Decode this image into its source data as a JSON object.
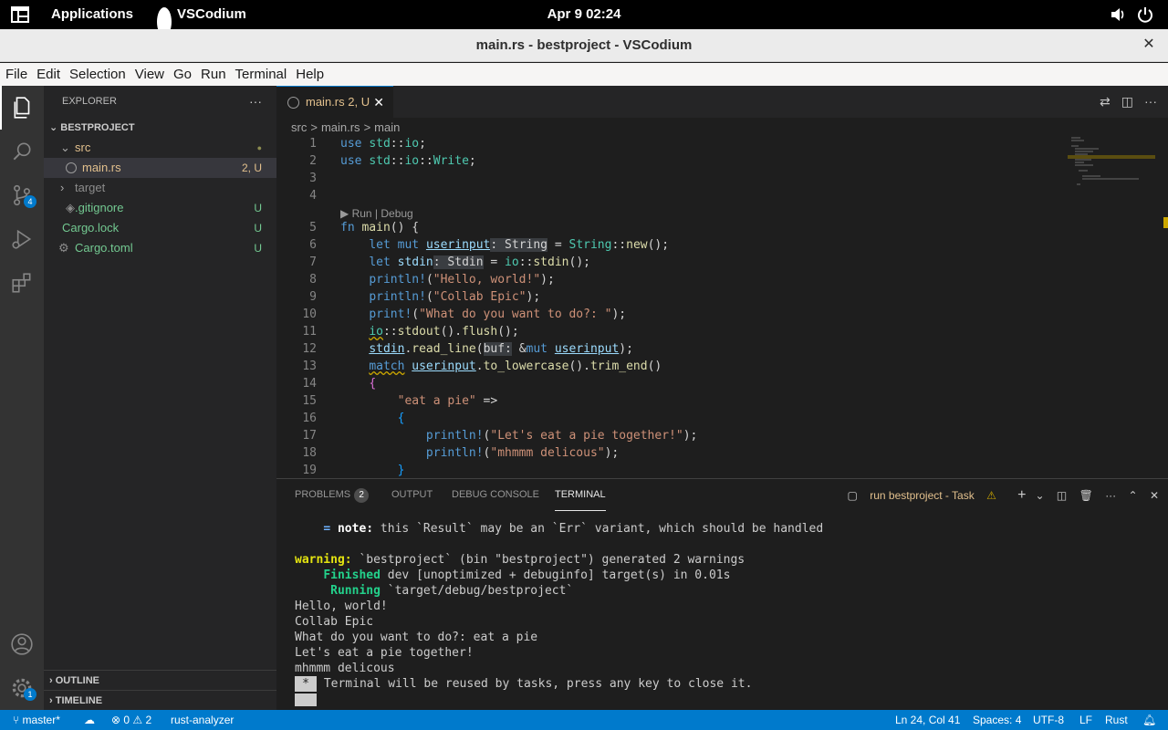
{
  "topbar": {
    "applications": "Applications",
    "app_name": "VSCodium",
    "clock": "Apr 9  02:24"
  },
  "window": {
    "title": "main.rs - bestproject - VSCodium",
    "close": "✕"
  },
  "menu": [
    "File",
    "Edit",
    "Selection",
    "View",
    "Go",
    "Run",
    "Terminal",
    "Help"
  ],
  "activity_bar": {
    "scm_badge": "4",
    "settings_badge": "1"
  },
  "explorer": {
    "header": "EXPLORER",
    "more": "···",
    "project": "BESTPROJECT",
    "items": [
      {
        "name": "src",
        "deco": "●"
      },
      {
        "name": "main.rs",
        "deco": "2, U"
      },
      {
        "name": "target",
        "deco": ""
      },
      {
        "name": ".gitignore",
        "deco": "U"
      },
      {
        "name": "Cargo.lock",
        "deco": "U"
      },
      {
        "name": "Cargo.toml",
        "deco": "U"
      }
    ],
    "outline": "OUTLINE",
    "timeline": "TIMELINE"
  },
  "editor": {
    "tab_label": "main.rs",
    "tab_status": "2, U",
    "breadcrumb": [
      "src",
      ">",
      "main.rs",
      ">",
      "main"
    ],
    "codelens": "▶ Run | Debug",
    "line_numbers": [
      "1",
      "2",
      "3",
      "4",
      "5",
      "6",
      "7",
      "8",
      "9",
      "10",
      "11",
      "12",
      "13",
      "14",
      "15",
      "16",
      "17",
      "18",
      "19"
    ]
  },
  "panel": {
    "tabs": [
      "PROBLEMS",
      "OUTPUT",
      "DEBUG CONSOLE",
      "TERMINAL"
    ],
    "problems_count": "2",
    "task_label": "run bestproject - Task",
    "terminal_lines": [
      "= note: this `Result` may be an `Err` variant, which should be handled",
      "",
      "warning: `bestproject` (bin \"bestproject\") generated 2 warnings",
      "Finished dev [unoptimized + debuginfo] target(s) in 0.01s",
      "Running `target/debug/bestproject`",
      "Hello, world!",
      "Collab Epic",
      "What do you want to do?: eat a pie",
      "Let's eat a pie together!",
      "mhmmm delicous",
      "Terminal will be reused by tasks, press any key to close it."
    ],
    "reuse_marker": "*"
  },
  "statusbar": {
    "branch": "master*",
    "errors": "0",
    "warnings": "2",
    "analyzer": "rust-analyzer",
    "position": "Ln 24, Col 41",
    "spaces": "Spaces: 4",
    "encoding": "UTF-8",
    "eol": "LF",
    "language": "Rust"
  },
  "colors": {
    "accent": "#007acc",
    "untracked": "#73c991",
    "warning": "#cca700"
  }
}
